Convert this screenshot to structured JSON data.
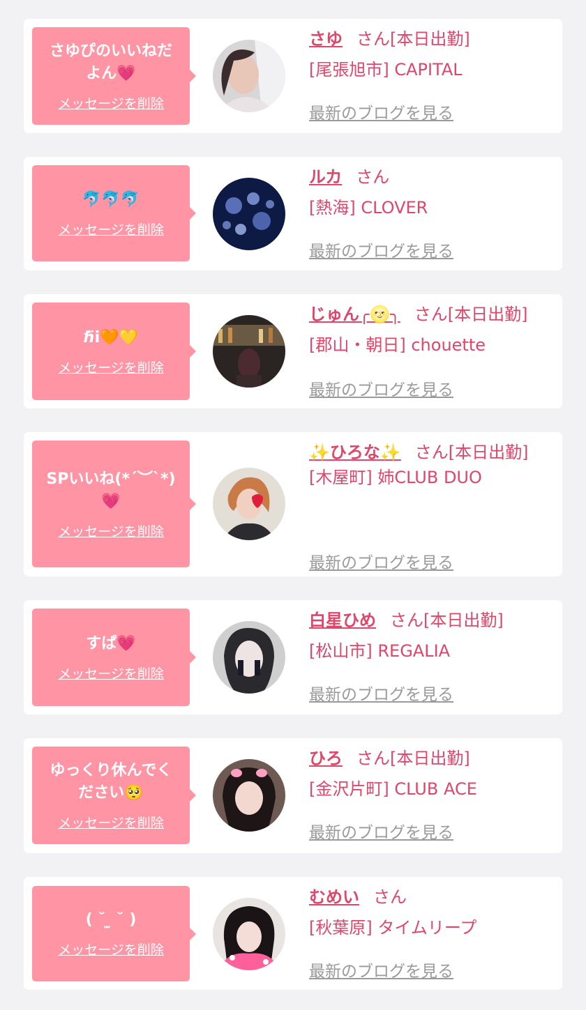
{
  "colors": {
    "background": "#f2f2f4",
    "card": "#ffffff",
    "bubble": "#ff94a4",
    "accent": "#e0456a",
    "muted_link": "#9a9a9a"
  },
  "items": [
    {
      "message": "さゆぴのいいねだ\nよん💗",
      "delete_label": "メッセージを削除",
      "name": "さゆ",
      "honorific": "さん",
      "status": "[本日出勤]",
      "shop": "[尾張旭市] CAPITAL",
      "blog_link": "最新のブログを見る",
      "avatar_icon": "avatar-photo"
    },
    {
      "message": "🐬🐬🐬",
      "delete_label": "メッセージを削除",
      "name": "ルカ",
      "honorific": "さん",
      "status": "",
      "shop": "[熱海] CLOVER",
      "blog_link": "最新のブログを見る",
      "avatar_icon": "jellyfish-photo"
    },
    {
      "message": "ℏ̈i🧡💛",
      "delete_label": "メッセージを削除",
      "name": "じゅん╭🌝╮",
      "honorific": "さん",
      "status": "[本日出勤]",
      "shop": "[郡山・朝日] chouette",
      "blog_link": "最新のブログを見る",
      "avatar_icon": "bar-photo"
    },
    {
      "message": "SPいいね(*´︶`*)\n💗",
      "delete_label": "メッセージを削除",
      "name": "✨ひろな✨",
      "honorific": "さん",
      "status": "[本日出勤]",
      "shop": "[木屋町] 姉CLUB DUO",
      "blog_link": "最新のブログを見る",
      "avatar_icon": "avatar-photo"
    },
    {
      "message": "すぱ💗",
      "delete_label": "メッセージを削除",
      "name": "白星ひめ",
      "honorific": "さん",
      "status": "[本日出勤]",
      "shop": "[松山市] REGALIA",
      "blog_link": "最新のブログを見る",
      "avatar_icon": "avatar-photo"
    },
    {
      "message": "ゆっくり休んでく\nださい🥺",
      "delete_label": "メッセージを削除",
      "name": "ひろ",
      "honorific": "さん",
      "status": "[本日出勤]",
      "shop": "[金沢片町] CLUB ACE",
      "blog_link": "最新のブログを見る",
      "avatar_icon": "avatar-photo"
    },
    {
      "message": "( ˘ ̫ ˘ )",
      "delete_label": "メッセージを削除",
      "name": "むめい",
      "honorific": "さん",
      "status": "",
      "shop": "[秋葉原] タイムリープ",
      "blog_link": "最新のブログを見る",
      "avatar_icon": "avatar-photo"
    }
  ]
}
